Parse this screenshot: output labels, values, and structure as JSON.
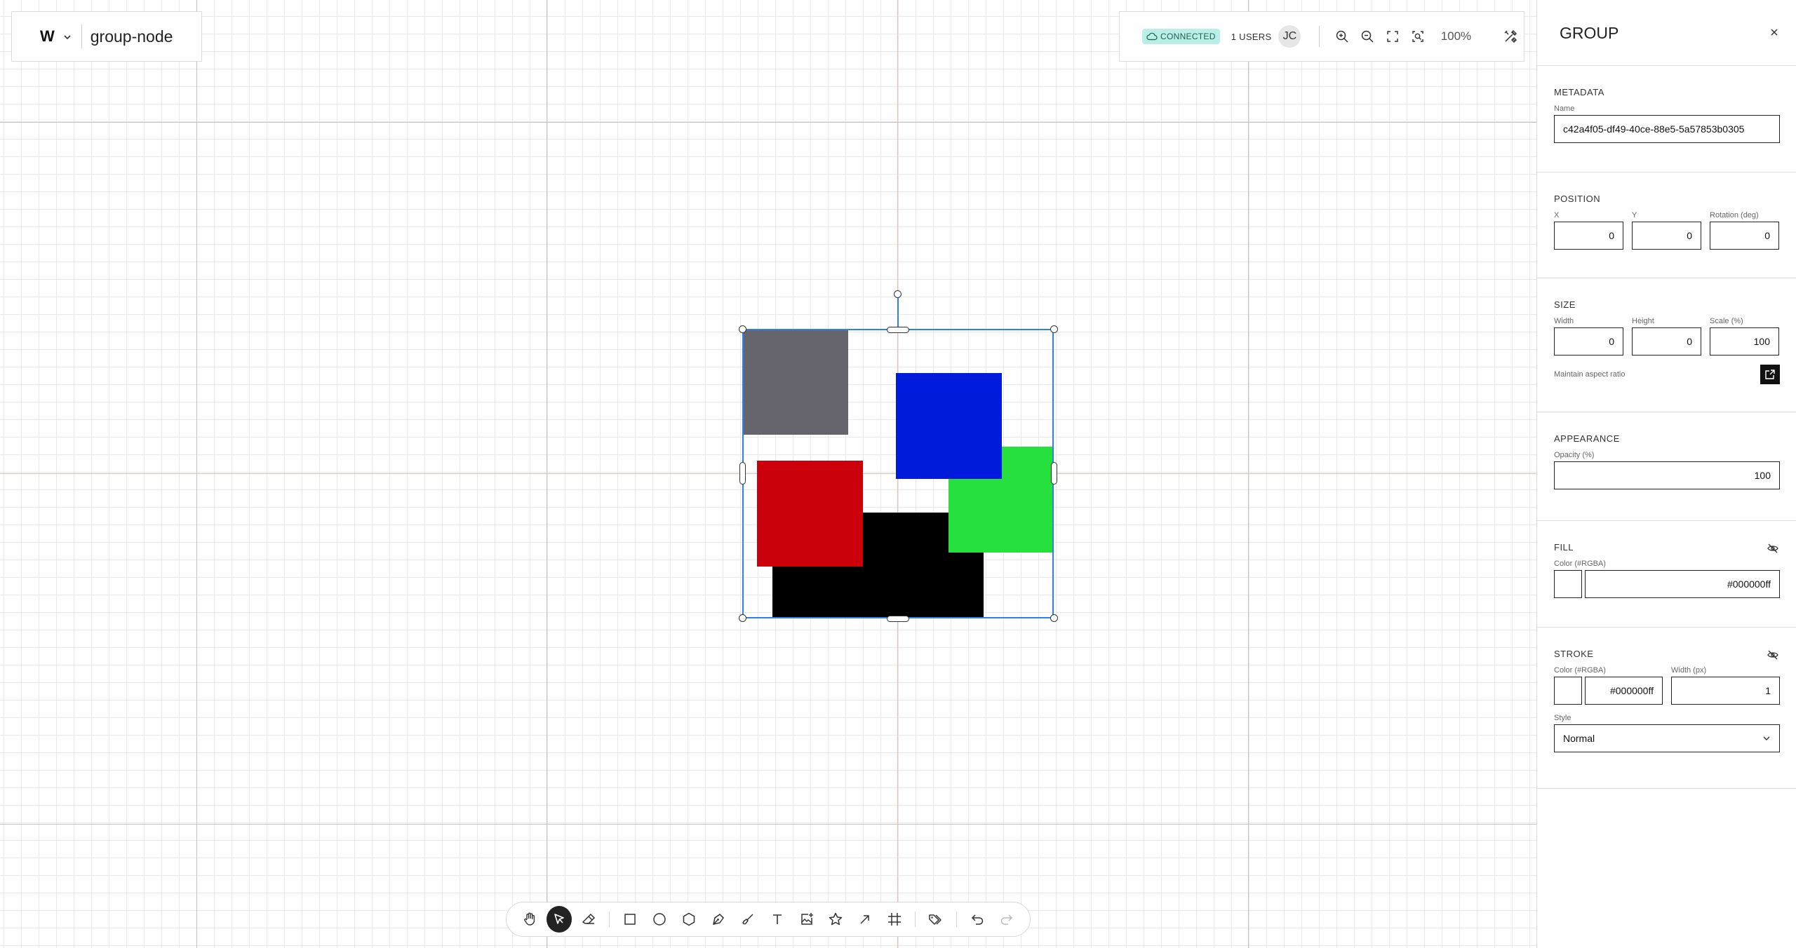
{
  "project": {
    "logo": "W",
    "name": "group-node"
  },
  "status": {
    "connection": "CONNECTED",
    "users": "1  USERS",
    "avatar_initials": "JC",
    "zoom": "100%"
  },
  "canvas": {
    "shapes": [
      {
        "name": "gray-rectangle",
        "color": "#66656d"
      },
      {
        "name": "blue-rectangle",
        "color": "#001bdc"
      },
      {
        "name": "green-rectangle",
        "color": "#26e03d"
      },
      {
        "name": "black-rectangle",
        "color": "#000000"
      },
      {
        "name": "red-rectangle",
        "color": "#cc000b"
      }
    ],
    "selection_color": "#2f80ed"
  },
  "toolbar": {
    "tools": [
      "hand-icon",
      "select-icon",
      "eraser-icon",
      "rectangle-icon",
      "ellipse-icon",
      "polygon-icon",
      "pen-icon",
      "brush-icon",
      "text-icon",
      "image-icon",
      "star-icon",
      "arrow-icon",
      "frame-icon",
      "tags-icon",
      "undo-icon",
      "redo-icon"
    ],
    "active_tool": "select-icon"
  },
  "panel": {
    "title": "GROUP",
    "metadata": {
      "title": "METADATA",
      "name_label": "Name",
      "name_value": "c42a4f05-df49-40ce-88e5-5a57853b0305"
    },
    "position": {
      "title": "POSITION",
      "x_label": "X",
      "x_value": "0",
      "y_label": "Y",
      "y_value": "0",
      "rotation_label": "Rotation (deg)",
      "rotation_value": "0"
    },
    "size": {
      "title": "SIZE",
      "width_label": "Width",
      "width_value": "0",
      "height_label": "Height",
      "height_value": "0",
      "scale_label": "Scale (%)",
      "scale_value": "100",
      "aspect_label": "Maintain aspect ratio"
    },
    "appearance": {
      "title": "APPEARANCE",
      "opacity_label": "Opacity (%)",
      "opacity_value": "100"
    },
    "fill": {
      "title": "FILL",
      "color_label": "Color (#RGBA)",
      "color_value": "#000000ff"
    },
    "stroke": {
      "title": "STROKE",
      "color_label": "Color (#RGBA)",
      "color_value": "#000000ff",
      "width_label": "Width (px)",
      "width_value": "1",
      "style_label": "Style",
      "style_value": "Normal"
    }
  }
}
